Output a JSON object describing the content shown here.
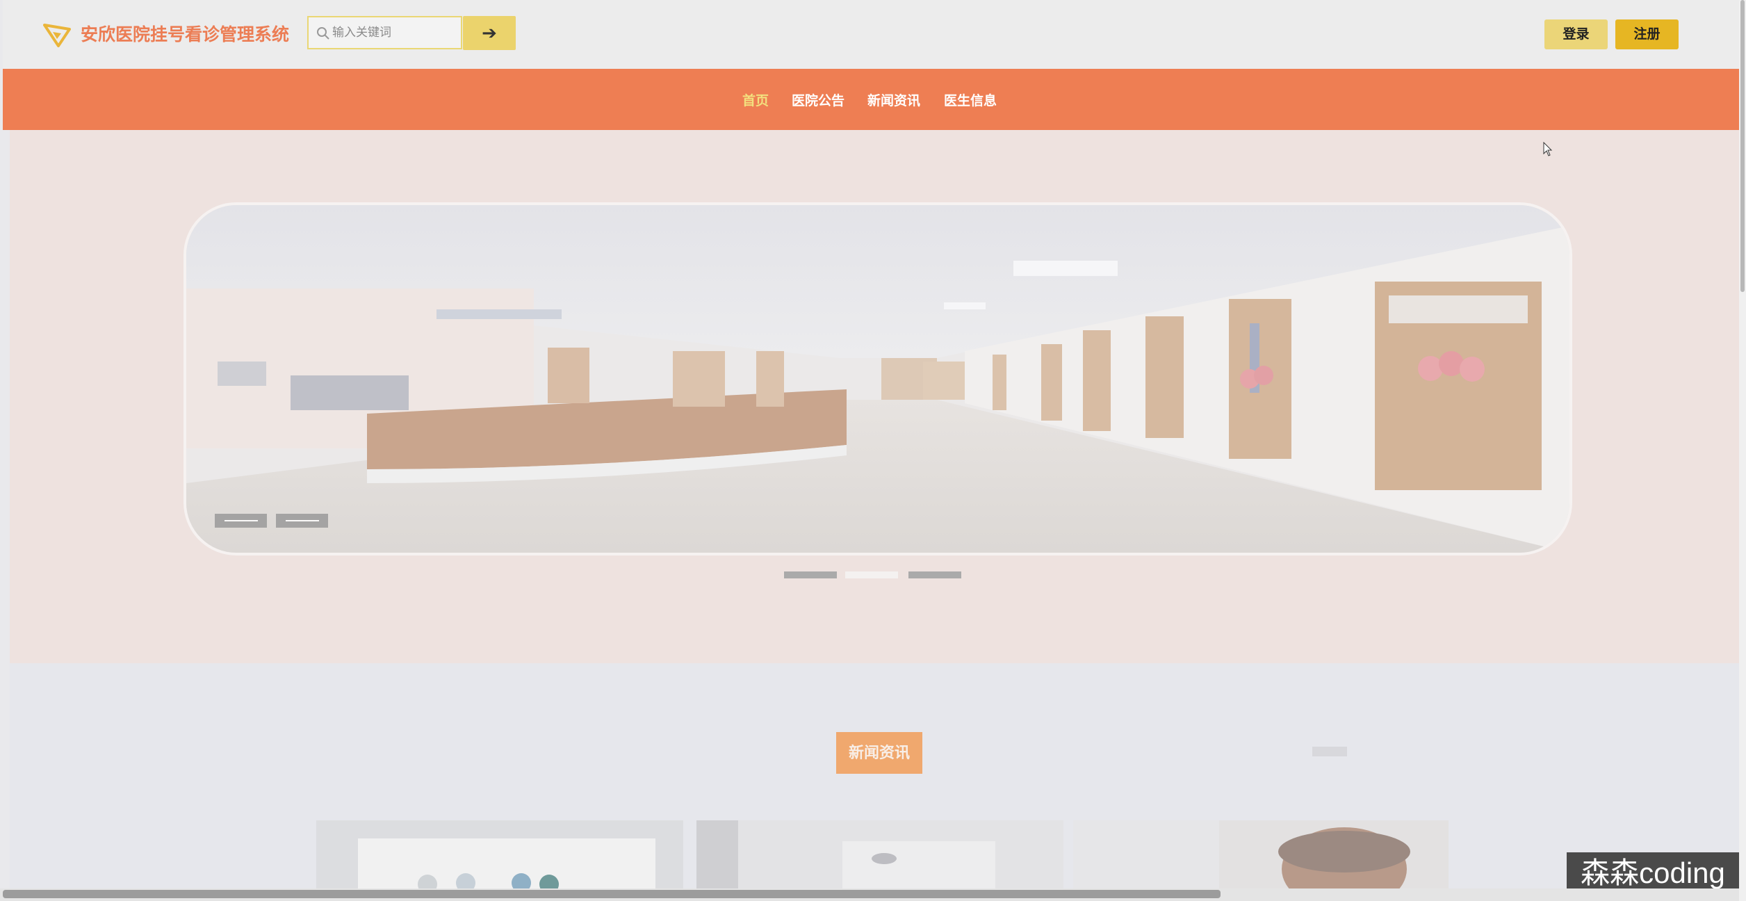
{
  "header": {
    "site_title": "安欣医院挂号看诊管理系统",
    "logo_icon": "paper-plane-icon",
    "search": {
      "placeholder": "输入关键词",
      "value": "",
      "button_icon": "arrow-right-icon"
    },
    "login_label": "登录",
    "register_label": "注册"
  },
  "nav": {
    "items": [
      {
        "label": "首页",
        "active": true
      },
      {
        "label": "医院公告",
        "active": false
      },
      {
        "label": "新闻资讯",
        "active": false
      },
      {
        "label": "医生信息",
        "active": false
      }
    ]
  },
  "banner": {
    "slide_count": 3,
    "active_slide": 2,
    "image": "hospital-corridor-image"
  },
  "news": {
    "title": "新闻资讯"
  },
  "watermark": "森森coding",
  "colors": {
    "accent": "#ee7e53",
    "brand_text": "#ec7d54",
    "login": "#ebd578",
    "register": "#e6b623",
    "nav_active": "#f3e07e"
  }
}
